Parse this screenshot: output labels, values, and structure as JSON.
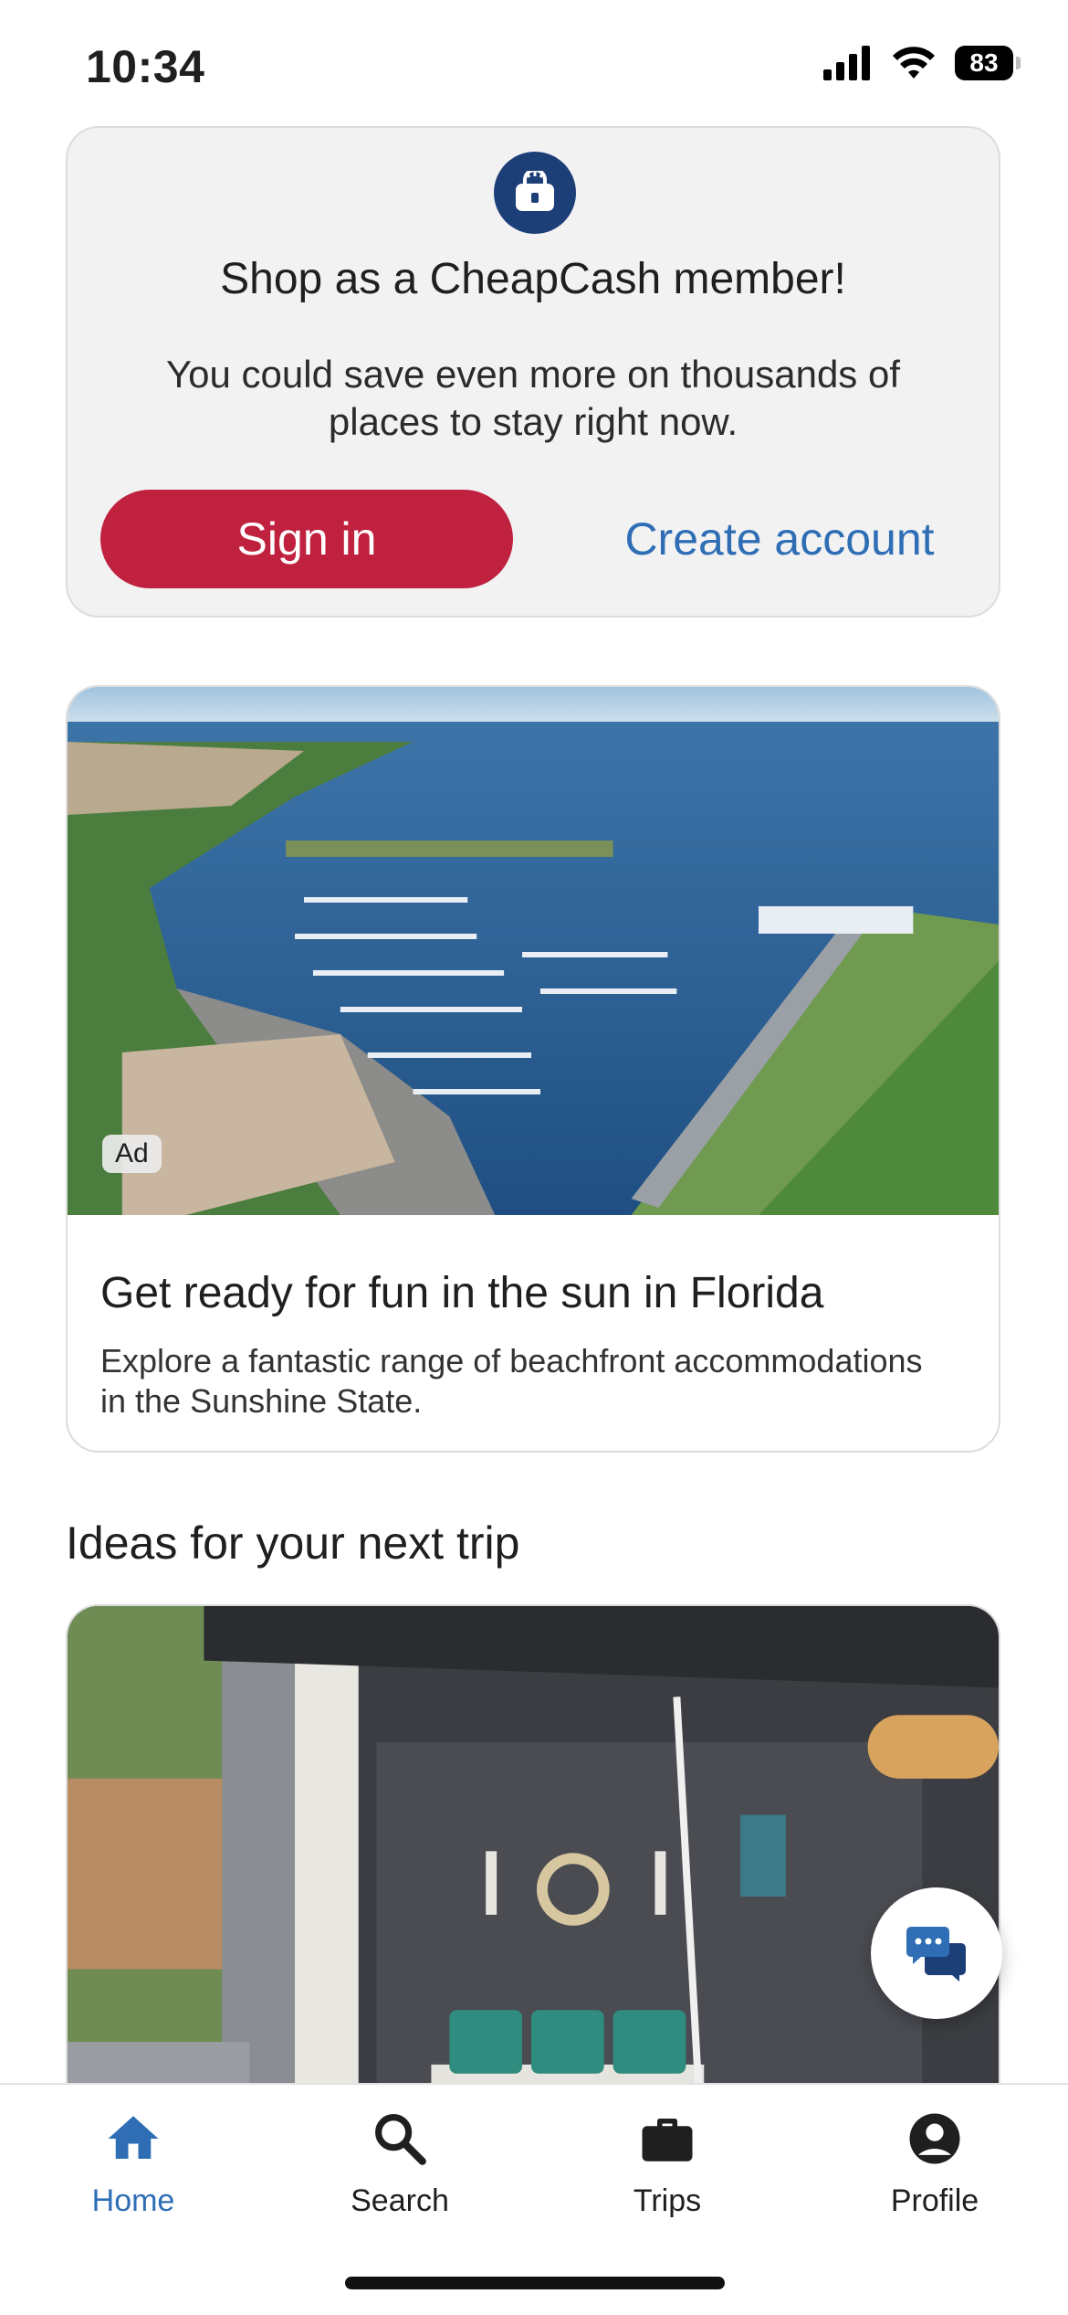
{
  "status_bar": {
    "time": "10:34",
    "battery": "83"
  },
  "member_card": {
    "title": "Shop as a CheapCash member!",
    "description": "You could save even more on thousands of places to stay right now.",
    "sign_in_label": "Sign in",
    "create_account_label": "Create account"
  },
  "ad_card": {
    "badge": "Ad",
    "title": "Get ready for fun in the sun in Florida",
    "description": "Explore a fantastic range of beachfront accommodations in the Sunshine State."
  },
  "section": {
    "title": "Ideas for your next trip"
  },
  "bottom_nav": {
    "items": [
      {
        "label": "Home",
        "icon": "home-icon",
        "active": true
      },
      {
        "label": "Search",
        "icon": "search-icon",
        "active": false
      },
      {
        "label": "Trips",
        "icon": "briefcase-icon",
        "active": false
      },
      {
        "label": "Profile",
        "icon": "profile-icon",
        "active": false
      }
    ]
  },
  "colors": {
    "brand_red": "#c0213f",
    "link_blue": "#2f6eb5",
    "icon_navy": "#1d3f78"
  }
}
